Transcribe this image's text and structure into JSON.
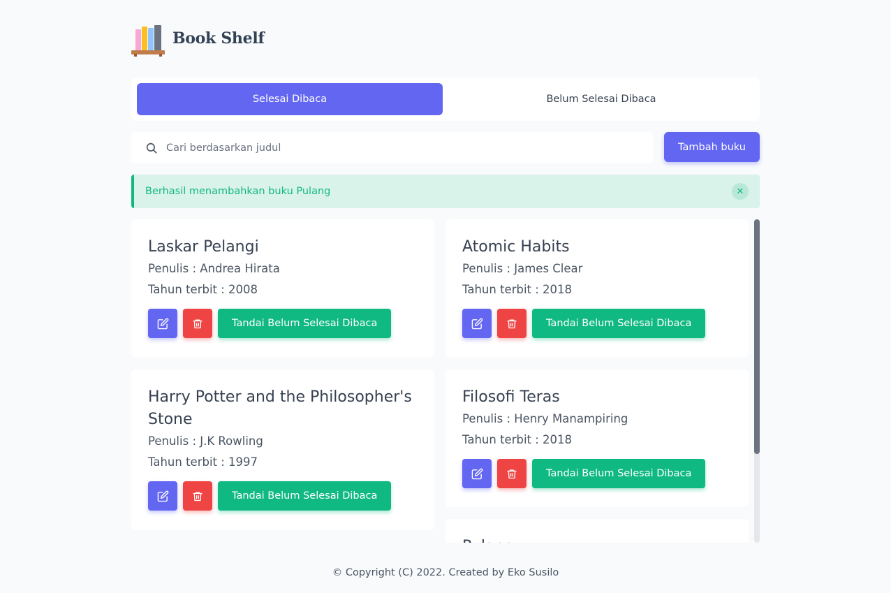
{
  "header": {
    "brand": "Book Shelf",
    "logo_icon": "bookshelf-icon"
  },
  "tabs": [
    {
      "label": "Selesai Dibaca",
      "active": true
    },
    {
      "label": "Belum Selesai Dibaca",
      "active": false
    }
  ],
  "search": {
    "placeholder": "Cari berdasarkan judul",
    "value": ""
  },
  "add_button": {
    "label": "Tambah buku"
  },
  "alert": {
    "message": "Berhasil menambahkan buku Pulang",
    "close_icon": "close-icon"
  },
  "books": [
    {
      "title": "Laskar Pelangi",
      "author": "Penulis : Andrea Hirata",
      "year": "Tahun terbit : 2008",
      "action": "Tandai Belum Selesai Dibaca"
    },
    {
      "title": "Atomic Habits",
      "author": "Penulis : James Clear",
      "year": "Tahun terbit : 2018",
      "action": "Tandai Belum Selesai Dibaca"
    },
    {
      "title": "Harry Potter and the Philosopher's Stone",
      "author": "Penulis : J.K Rowling",
      "year": "Tahun terbit : 1997",
      "action": "Tandai Belum Selesai Dibaca"
    },
    {
      "title": "Filosofi Teras",
      "author": "Penulis : Henry Manampiring",
      "year": "Tahun terbit : 2018",
      "action": "Tandai Belum Selesai Dibaca"
    },
    {
      "title": "Pulang"
    }
  ],
  "footer": {
    "text": "© Copyright (C) 2022. Created by Eko Susilo"
  },
  "colors": {
    "primary": "#6366f1",
    "danger": "#ef4444",
    "success": "#10b981",
    "background": "#f8fafc"
  }
}
